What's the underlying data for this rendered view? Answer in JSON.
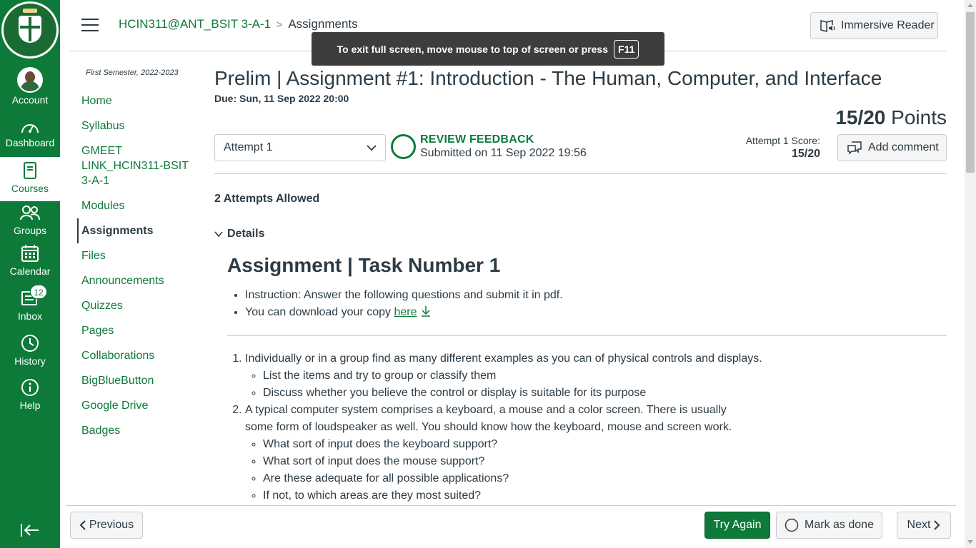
{
  "global_nav": {
    "account": "Account",
    "dashboard": "Dashboard",
    "courses": "Courses",
    "groups": "Groups",
    "calendar": "Calendar",
    "inbox": "Inbox",
    "inbox_count": "12",
    "history": "History",
    "help": "Help"
  },
  "header": {
    "course_link": "HCIN311@ANT_BSIT 3-A-1",
    "current_page": "Assignments",
    "immersive_reader": "Immersive Reader"
  },
  "fullscreen_toast": {
    "message": "To exit full screen, move mouse to top of screen or press",
    "key": "F11"
  },
  "course_nav": {
    "term": "First Semester, 2022-2023",
    "items": [
      {
        "label": "Home"
      },
      {
        "label": "Syllabus"
      },
      {
        "label": "GMEET LINK_HCIN311-BSIT 3-A-1"
      },
      {
        "label": "Modules"
      },
      {
        "label": "Assignments"
      },
      {
        "label": "Files"
      },
      {
        "label": "Announcements"
      },
      {
        "label": "Quizzes"
      },
      {
        "label": "Pages"
      },
      {
        "label": "Collaborations"
      },
      {
        "label": "BigBlueButton"
      },
      {
        "label": "Google Drive"
      },
      {
        "label": "Badges"
      }
    ]
  },
  "assignment": {
    "title": "Prelim | Assignment #1: Introduction - The Human, Computer, and Interface",
    "due": "Due: Sun, 11 Sep 2022 20:00",
    "points_score": "15/20",
    "points_label": "Points",
    "attempt_selected": "Attempt 1",
    "review_feedback": "REVIEW FEEDBACK",
    "submitted": "Submitted on 11 Sep 2022 19:56",
    "attempt_score_label": "Attempt 1 Score:",
    "attempt_score_value": "15/20",
    "add_comment": "Add comment",
    "attempts_allowed": "2 Attempts Allowed",
    "details_label": "Details"
  },
  "content": {
    "heading": "Assignment | Task Number 1",
    "bullet_1": "Instruction: Answer the following questions and submit it in pdf.",
    "bullet_2_prefix": "You can download your copy",
    "bullet_2_link": "here",
    "q1": "Individually or in a group find as many different examples as you can of physical controls and displays.",
    "q1_sub": [
      "List the items and try to group or classify them",
      "Discuss whether you believe the control or display is suitable for its purpose"
    ],
    "q2_line1": "A typical computer system comprises a keyboard, a mouse and a color screen. There is usually",
    "q2_line2": "some form of loudspeaker as well. You should know how the keyboard, mouse and screen work.",
    "q2_sub": [
      "What sort of input does the keyboard support?",
      "What sort of input does the mouse support?",
      "Are these adequate for all possible applications?",
      "If not, to which areas are they most suited?"
    ]
  },
  "footer": {
    "previous": "Previous",
    "try_again": "Try Again",
    "mark_as_done": "Mark as done",
    "next": "Next"
  },
  "colors": {
    "brand_green": "#0e7a3a",
    "text": "#2d3b45",
    "border": "#c7cdd1"
  }
}
